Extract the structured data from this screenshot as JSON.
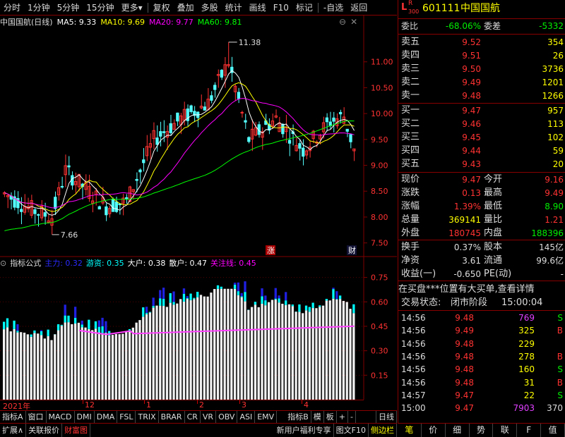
{
  "toolbar": {
    "items": [
      "分时",
      "1分钟",
      "5分钟",
      "15分钟",
      "更多▾",
      "复权",
      "叠加",
      "多股",
      "统计",
      "画线",
      "F10",
      "标记",
      "-自选",
      "返回"
    ]
  },
  "info": {
    "name": "中国国航(日线)",
    "ma5_label": "MA5: 9.33",
    "ma10_label": "MA10: 9.69",
    "ma20_label": "MA20: 9.77",
    "ma60_label": "MA60: 9.81",
    "high_mark": "11.38",
    "low_mark": "7.66",
    "badge_zhang": "涨",
    "badge_cai": "财"
  },
  "colors": {
    "up": "#ff3232",
    "down": "#54ffff",
    "ma5": "#ffffff",
    "ma10": "#ffff00",
    "ma20": "#ff00ff",
    "ma60": "#00ff00",
    "grid": "#800000",
    "axis_text": "#ff3232",
    "green": "#00e000",
    "yellow": "#ffff00",
    "cyan": "#00ffff",
    "magenta": "#ff40ff",
    "white": "#ffffff"
  },
  "indicator": {
    "prefix": "指标公式",
    "zhuli": "主力: 0.32",
    "youzi": "游资: 0.35",
    "dahu": "大户: 0.38",
    "sanhu": "散户: 0.47",
    "guanzhu": "关注线: 0.45"
  },
  "chart_data": {
    "type": "candlestick",
    "price_axis": [
      "11.00",
      "10.50",
      "10.00",
      "9.50",
      "9.00",
      "8.50",
      "8.00",
      "7.50"
    ],
    "price_range": [
      7.25,
      11.65
    ],
    "ind_axis": [
      "0.75",
      "0.60",
      "0.45",
      "0.30",
      "0.15"
    ],
    "ind_range": [
      0.0,
      0.8
    ],
    "time_labels": [
      "2021年",
      "12",
      "1",
      "2",
      "3",
      "4"
    ]
  },
  "tabs_row1": [
    "指标A",
    "窗口",
    "MACD",
    "DMI",
    "DMA",
    "FSL",
    "TRIX",
    "BRAR",
    "CR",
    "VR",
    "OBV",
    "ASI",
    "EMV",
    "指标B",
    "模",
    "板",
    "+",
    "-",
    "日线"
  ],
  "tabs_row2": [
    "扩展∧",
    "关联报价",
    "财富图",
    "新用户福利专享",
    "图文F10",
    "侧边栏"
  ],
  "stock": {
    "prefix": "L",
    "sup": "R",
    "sub": "300",
    "code": "601111",
    "name": "中国国航"
  },
  "weibi": {
    "label": "委比",
    "value": "-68.06%",
    "label2": "委差",
    "value2": "-5332"
  },
  "sell": [
    {
      "label": "卖五",
      "price": "9.52",
      "vol": "354"
    },
    {
      "label": "卖四",
      "price": "9.51",
      "vol": "26"
    },
    {
      "label": "卖三",
      "price": "9.50",
      "vol": "3736"
    },
    {
      "label": "卖二",
      "price": "9.49",
      "vol": "1201"
    },
    {
      "label": "卖一",
      "price": "9.48",
      "vol": "1266"
    }
  ],
  "buy": [
    {
      "label": "买一",
      "price": "9.47",
      "vol": "957"
    },
    {
      "label": "买二",
      "price": "9.46",
      "vol": "113"
    },
    {
      "label": "买三",
      "price": "9.45",
      "vol": "102"
    },
    {
      "label": "买四",
      "price": "9.44",
      "vol": "59"
    },
    {
      "label": "买五",
      "price": "9.43",
      "vol": "20"
    }
  ],
  "quote": [
    {
      "l1": "现价",
      "v1": "9.47",
      "l2": "今开",
      "v2": "9.16"
    },
    {
      "l1": "涨跌",
      "v1": "0.13",
      "l2": "最高",
      "v2": "9.49"
    },
    {
      "l1": "涨幅",
      "v1": "1.39%",
      "l2": "最低",
      "v2": "8.90"
    },
    {
      "l1": "总量",
      "v1": "369141",
      "l2": "量比",
      "v2": "1.21"
    },
    {
      "l1": "外盘",
      "v1": "180745",
      "l2": "内盘",
      "v2": "188396"
    }
  ],
  "stats": [
    {
      "l1": "换手",
      "v1": "0.37%",
      "l2": "股本",
      "v2": "145亿"
    },
    {
      "l1": "净资",
      "v1": "3.61",
      "l2": "流通",
      "v2": "99.6亿"
    },
    {
      "l1": "收益(一)",
      "v1": "-0.650",
      "l2": "PE(动)",
      "v2": "-"
    }
  ],
  "notice": "在买盘***位置有大买单,查看详情",
  "trade_status": {
    "label": "交易状态:",
    "value": "闭市阶段",
    "time": "15:00:04"
  },
  "ticks": [
    {
      "t": "14:56",
      "p": "9.48",
      "v": "769",
      "s": "S"
    },
    {
      "t": "14:56",
      "p": "9.49",
      "v": "325",
      "s": "B"
    },
    {
      "t": "14:56",
      "p": "9.48",
      "v": "229",
      "s": ""
    },
    {
      "t": "14:56",
      "p": "9.48",
      "v": "278",
      "s": "B"
    },
    {
      "t": "14:56",
      "p": "9.48",
      "v": "160",
      "s": "S"
    },
    {
      "t": "14:56",
      "p": "9.48",
      "v": "31",
      "s": "B"
    },
    {
      "t": "14:57",
      "p": "9.47",
      "v": "22",
      "s": "S"
    },
    {
      "t": "15:00",
      "p": "9.47",
      "v": "7903",
      "s": "370"
    }
  ],
  "bottom_nav": [
    "笔",
    "价",
    "细",
    "势",
    "联",
    "F",
    "值"
  ]
}
